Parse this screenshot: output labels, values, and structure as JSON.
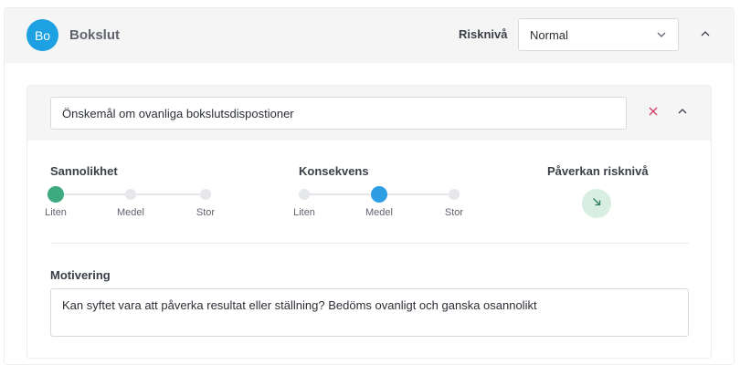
{
  "section": {
    "avatar_initials": "Bo",
    "title": "Bokslut",
    "risk_level_label": "Risknivå",
    "risk_level_value": "Normal"
  },
  "risk_item": {
    "title_value": "Önskemål om ovanliga bokslutsdispostioner",
    "likelihood": {
      "label": "Sannolikhet",
      "options": [
        "Liten",
        "Medel",
        "Stor"
      ],
      "selected": "Liten",
      "active_color": "#3daa7f"
    },
    "consequence": {
      "label": "Konsekvens",
      "options": [
        "Liten",
        "Medel",
        "Stor"
      ],
      "selected": "Medel",
      "active_color": "#2d9ee3"
    },
    "impact": {
      "label": "Påverkan risknivå",
      "icon": "arrow-down-right-icon"
    },
    "motivation": {
      "label": "Motivering",
      "value": "Kan syftet vara att påverka resultat eller ställning? Bedöms ovanligt och ganska osannolikt"
    }
  },
  "colors": {
    "avatar": "#1ea1e3",
    "close_icon": "#d0416a",
    "impact_bg": "#d8eee3",
    "impact_arrow": "#2e7d5b"
  }
}
